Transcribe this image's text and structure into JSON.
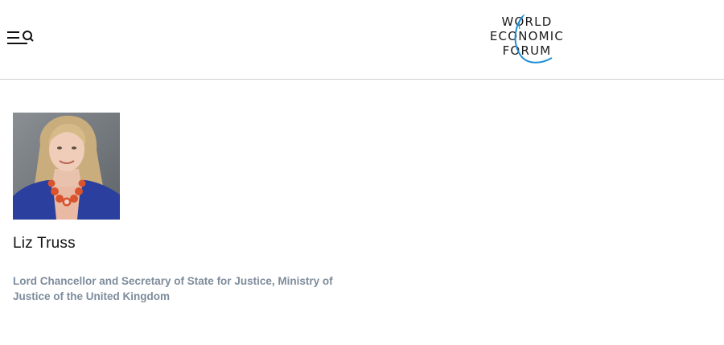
{
  "header": {
    "menu_icon": "menu-search-icon",
    "logo": {
      "line1": "WORLD",
      "line2": "ECONOMIC",
      "line3": "FORUM",
      "accent_color": "#1f8fd6"
    }
  },
  "profile": {
    "name": "Liz Truss",
    "title": "Lord Chancellor and Secretary of State for Justice, Ministry of Justice of the United Kingdom",
    "photo_alt": "Liz Truss"
  }
}
